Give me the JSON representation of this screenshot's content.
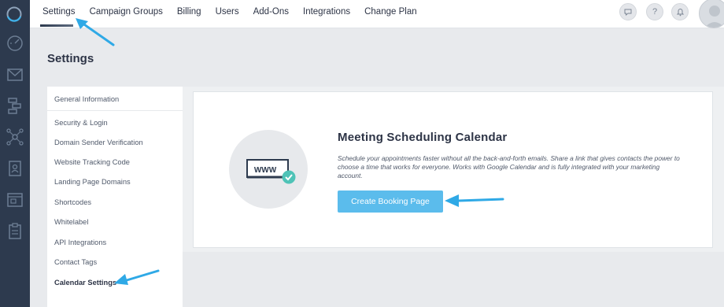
{
  "topbar": {
    "tabs": [
      {
        "label": "Settings"
      },
      {
        "label": "Campaign Groups"
      },
      {
        "label": "Billing"
      },
      {
        "label": "Users"
      },
      {
        "label": "Add-Ons"
      },
      {
        "label": "Integrations"
      },
      {
        "label": "Change Plan"
      }
    ],
    "help_label": "?"
  },
  "page": {
    "title": "Settings"
  },
  "menu": {
    "items": [
      {
        "label": "General Information"
      },
      {
        "label": "Security & Login"
      },
      {
        "label": "Domain Sender Verification"
      },
      {
        "label": "Website Tracking Code"
      },
      {
        "label": "Landing Page Domains"
      },
      {
        "label": "Shortcodes"
      },
      {
        "label": "Whitelabel"
      },
      {
        "label": "API Integrations"
      },
      {
        "label": "Contact Tags"
      },
      {
        "label": "Calendar Settings"
      }
    ]
  },
  "feature": {
    "illustration_text": "WWW",
    "title": "Meeting Scheduling Calendar",
    "description": "Schedule your appointments faster without all the back-and-forth emails. Share a link that gives contacts the power to choose a time that works for everyone. Works with Google Calendar and is fully integrated with your marketing account.",
    "button_label": "Create Booking Page"
  },
  "colors": {
    "sidebar": "#2d3a4e",
    "accent": "#5bbcec",
    "annotation_arrow": "#2fa9e6",
    "check": "#4fc3b7"
  }
}
